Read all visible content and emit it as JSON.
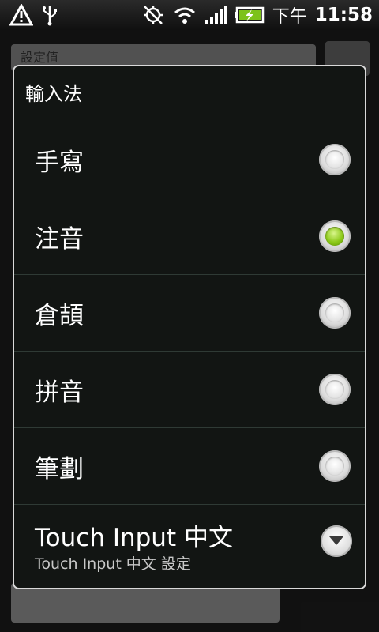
{
  "status_bar": {
    "ampm": "下午",
    "time": "11:58",
    "icons": [
      "warning-icon",
      "usb-icon",
      "gps-off-icon",
      "wifi-icon",
      "signal-icon",
      "battery-charging-icon"
    ]
  },
  "background_app": {
    "field_text": "設定值"
  },
  "dialog": {
    "title": "輸入法",
    "options": [
      {
        "label": "手寫",
        "selected": false
      },
      {
        "label": "注音",
        "selected": true
      },
      {
        "label": "倉頡",
        "selected": false
      },
      {
        "label": "拼音",
        "selected": false
      },
      {
        "label": "筆劃",
        "selected": false
      }
    ],
    "touch_input": {
      "title": "Touch Input 中文",
      "subtitle": "Touch Input 中文 設定"
    }
  },
  "colors": {
    "accent": "#8cc919",
    "dialog_bg": "#121513",
    "dialog_border": "#d9d9d9"
  }
}
